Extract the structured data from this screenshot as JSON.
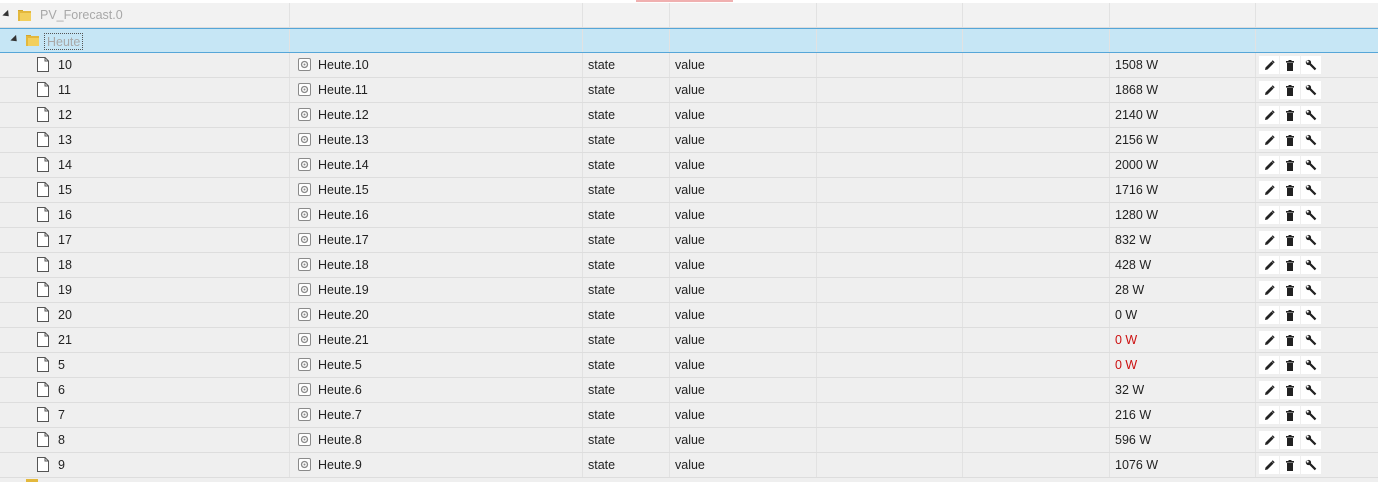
{
  "tree": {
    "root": {
      "label": "PV_Forecast.0"
    },
    "folder": {
      "label": "Heute"
    },
    "rows": [
      {
        "name": "10",
        "id": "Heute.10",
        "type": "state",
        "role": "value",
        "value": "1508 W",
        "highlight": false
      },
      {
        "name": "11",
        "id": "Heute.11",
        "type": "state",
        "role": "value",
        "value": "1868 W",
        "highlight": false
      },
      {
        "name": "12",
        "id": "Heute.12",
        "type": "state",
        "role": "value",
        "value": "2140 W",
        "highlight": false
      },
      {
        "name": "13",
        "id": "Heute.13",
        "type": "state",
        "role": "value",
        "value": "2156 W",
        "highlight": false
      },
      {
        "name": "14",
        "id": "Heute.14",
        "type": "state",
        "role": "value",
        "value": "2000 W",
        "highlight": false
      },
      {
        "name": "15",
        "id": "Heute.15",
        "type": "state",
        "role": "value",
        "value": "1716 W",
        "highlight": false
      },
      {
        "name": "16",
        "id": "Heute.16",
        "type": "state",
        "role": "value",
        "value": "1280 W",
        "highlight": false
      },
      {
        "name": "17",
        "id": "Heute.17",
        "type": "state",
        "role": "value",
        "value": "832 W",
        "highlight": false
      },
      {
        "name": "18",
        "id": "Heute.18",
        "type": "state",
        "role": "value",
        "value": "428 W",
        "highlight": false
      },
      {
        "name": "19",
        "id": "Heute.19",
        "type": "state",
        "role": "value",
        "value": "28 W",
        "highlight": false
      },
      {
        "name": "20",
        "id": "Heute.20",
        "type": "state",
        "role": "value",
        "value": "0 W",
        "highlight": false
      },
      {
        "name": "21",
        "id": "Heute.21",
        "type": "state",
        "role": "value",
        "value": "0 W",
        "highlight": true
      },
      {
        "name": "5",
        "id": "Heute.5",
        "type": "state",
        "role": "value",
        "value": "0 W",
        "highlight": true
      },
      {
        "name": "6",
        "id": "Heute.6",
        "type": "state",
        "role": "value",
        "value": "32 W",
        "highlight": false
      },
      {
        "name": "7",
        "id": "Heute.7",
        "type": "state",
        "role": "value",
        "value": "216 W",
        "highlight": false
      },
      {
        "name": "8",
        "id": "Heute.8",
        "type": "state",
        "role": "value",
        "value": "596 W",
        "highlight": false
      },
      {
        "name": "9",
        "id": "Heute.9",
        "type": "state",
        "role": "value",
        "value": "1076 W",
        "highlight": false
      }
    ]
  },
  "icons": {
    "expander": "triangle-down-right-icon",
    "folder": "folder-icon",
    "file": "file-icon",
    "state": "state-settings-icon",
    "edit": "pencil-icon",
    "delete": "trash-icon",
    "config": "wrench-icon"
  },
  "colors": {
    "row_background": "#efefef",
    "selected_background": "#c6e6f5",
    "selected_border": "#56a6d8",
    "ack_false_value": "#cc1111",
    "folder": "#e3b83c"
  }
}
